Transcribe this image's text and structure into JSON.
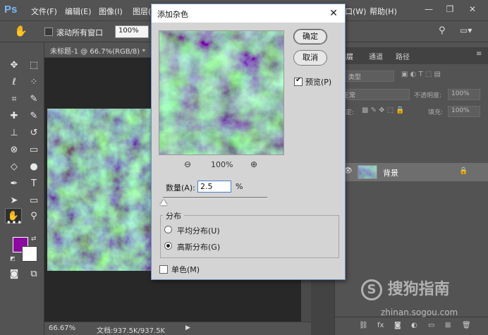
{
  "app": {
    "logo": "Ps"
  },
  "menu": {
    "items": [
      "文件(F)",
      "编辑(E)",
      "图像(I)",
      "图层(L)",
      "窗口(W)",
      "帮助(H)"
    ]
  },
  "options_bar": {
    "scroll_all_label": "滚动所有窗口",
    "zoom_value": "100%"
  },
  "document": {
    "tab_title": "未标题-1 @ 66.7%(RGB/8) *",
    "status_zoom": "66.67%",
    "status_doc": "文档:937.5K/937.5K"
  },
  "tools": [
    "✥",
    "⬚",
    "ℓ",
    "⁘",
    "⌗",
    "✎",
    "✚",
    "✎",
    "⊗",
    "▭",
    "⚲",
    "●",
    "✒",
    "T",
    "➤",
    "▭",
    "✋",
    "🔍",
    "•••"
  ],
  "layers_panel": {
    "tabs": [
      "图层",
      "通道",
      "路径"
    ],
    "kind_label": "类型",
    "blend_mode": "正常",
    "opacity_label": "不透明度:",
    "opacity_value": "100%",
    "lock_label": "锁定:",
    "fill_label": "填充:",
    "fill_value": "100%",
    "layer_name": "背景"
  },
  "dialog": {
    "title": "添加杂色",
    "ok_label": "确定",
    "cancel_label": "取消",
    "preview_label": "预览(P)",
    "preview_checked": true,
    "zoom_level": "100%",
    "amount_label": "数量(A):",
    "amount_value": "2.5",
    "amount_unit": "%",
    "amount_slider_fraction": 0.0063,
    "distribution_legend": "分布",
    "uniform_label": "平均分布(U)",
    "gaussian_label": "高斯分布(G)",
    "selected_distribution": "gaussian",
    "monochromatic_label": "单色(M)",
    "monochromatic_checked": false
  },
  "watermark": {
    "brand": "搜狗指南",
    "url": "zhinan.sogou.com"
  },
  "colors": {
    "foreground": "#8c0aa0",
    "background": "#ffffff",
    "texture_base": "#183c25",
    "texture_highlight": "#3ca85c",
    "texture_shadow": "#4a4080"
  }
}
